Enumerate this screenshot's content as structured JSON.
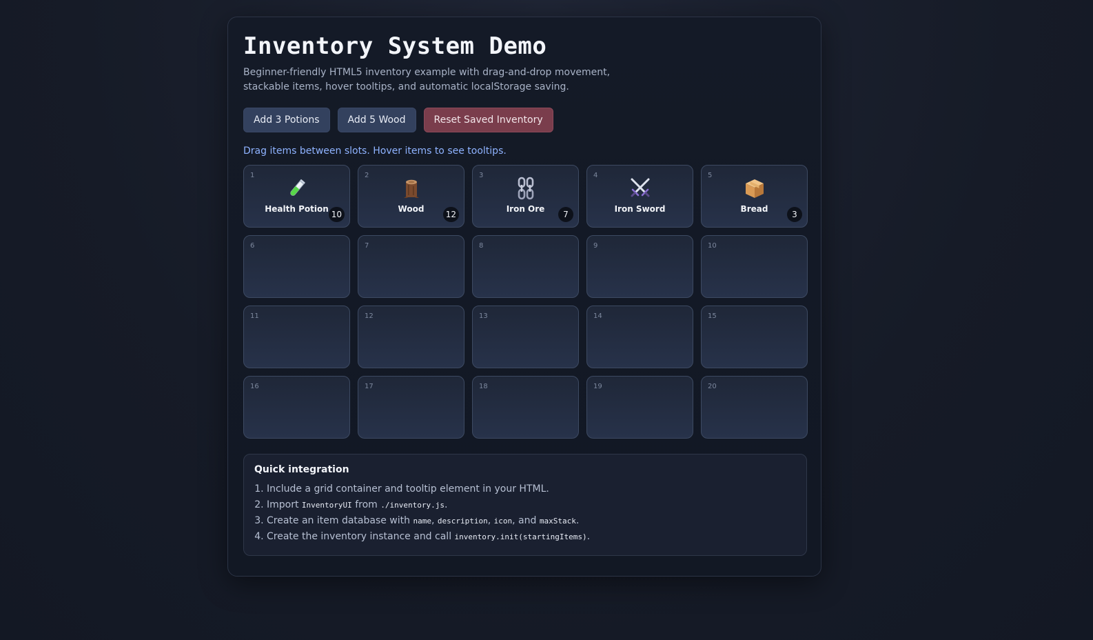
{
  "header": {
    "title": "Inventory System Demo",
    "subtitle": "Beginner-friendly HTML5 inventory example with drag-and-drop movement, stackable items, hover tooltips, and automatic localStorage saving."
  },
  "buttons": {
    "add_potions": "Add 3 Potions",
    "add_wood": "Add 5 Wood",
    "reset": "Reset Saved Inventory"
  },
  "hint": "Drag items between slots. Hover items to see tooltips.",
  "slots": [
    {
      "num": "1",
      "item": {
        "name": "Health Potion",
        "icon": "potion-icon",
        "count": "10"
      }
    },
    {
      "num": "2",
      "item": {
        "name": "Wood",
        "icon": "wood-log-icon",
        "count": "12"
      }
    },
    {
      "num": "3",
      "item": {
        "name": "Iron Ore",
        "icon": "chain-icon",
        "count": "7"
      }
    },
    {
      "num": "4",
      "item": {
        "name": "Iron Sword",
        "icon": "crossed-swords-icon",
        "count": ""
      }
    },
    {
      "num": "5",
      "item": {
        "name": "Bread",
        "icon": "box-icon",
        "count": "3"
      }
    },
    {
      "num": "6"
    },
    {
      "num": "7"
    },
    {
      "num": "8"
    },
    {
      "num": "9"
    },
    {
      "num": "10"
    },
    {
      "num": "11"
    },
    {
      "num": "12"
    },
    {
      "num": "13"
    },
    {
      "num": "14"
    },
    {
      "num": "15"
    },
    {
      "num": "16"
    },
    {
      "num": "17"
    },
    {
      "num": "18"
    },
    {
      "num": "19"
    },
    {
      "num": "20"
    }
  ],
  "integration": {
    "title": "Quick integration",
    "step1": "Include a grid container and tooltip element in your HTML.",
    "step2_a": "Import ",
    "step2_code1": "InventoryUI",
    "step2_b": " from ",
    "step2_code2": "./inventory.js",
    "step2_c": ".",
    "step3_a": "Create an item database with ",
    "step3_code1": "name",
    "step3_sep1": ", ",
    "step3_code2": "description",
    "step3_sep2": ", ",
    "step3_code3": "icon",
    "step3_sep3": ", and ",
    "step3_code4": "maxStack",
    "step3_end": ".",
    "step4_a": "Create the inventory instance and call ",
    "step4_code": "inventory.init(startingItems)",
    "step4_end": "."
  },
  "colors": {
    "accent": "#8fb3ff",
    "button": "#33415e",
    "danger": "#7a3d4c",
    "panel": "#141a27"
  }
}
